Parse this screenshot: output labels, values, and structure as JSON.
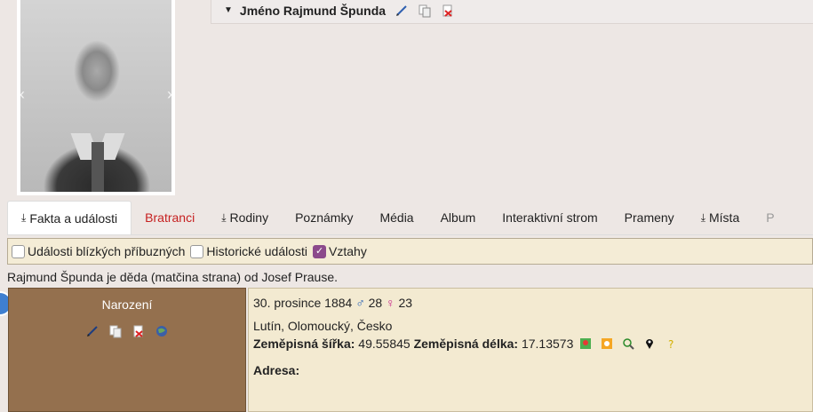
{
  "person": {
    "name_prefix": "Jméno",
    "name": "Rajmund Špunda"
  },
  "tabs": [
    {
      "label": "Fakta a události"
    },
    {
      "label": "Bratranci"
    },
    {
      "label": "Rodiny"
    },
    {
      "label": "Poznámky"
    },
    {
      "label": "Média"
    },
    {
      "label": "Album"
    },
    {
      "label": "Interaktivní strom"
    },
    {
      "label": "Prameny"
    },
    {
      "label": "Místa"
    },
    {
      "label": "P"
    }
  ],
  "filters": {
    "close_relatives": "Události blízkých příbuzných",
    "historical": "Historické události",
    "relationships": "Vztahy"
  },
  "relation_text": "Rajmund Špunda je děda (matčina strana) od Josef Prause.",
  "fact": {
    "label": "Narození",
    "date": "30. prosince 1884",
    "male_symbol": "♂",
    "father_age": "28",
    "female_symbol": "♀",
    "mother_age": "23",
    "place": "Lutín, Olomoucký, Česko",
    "lat_label": "Zeměpisná šířka:",
    "lat": "49.55845",
    "lon_label": "Zeměpisná délka:",
    "lon": "17.13573",
    "address_label": "Adresa:"
  },
  "colors": {
    "fact_label_bg": "#94704e",
    "fact_value_bg": "#f3ead1",
    "red_tab": "#c62020",
    "checkbox_on": "#8c4a8c"
  }
}
